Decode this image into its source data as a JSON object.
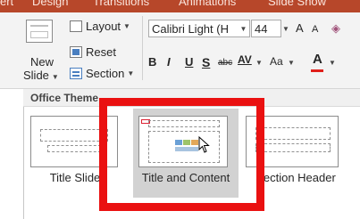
{
  "ribbon_tabs": [
    "ert",
    "Design",
    "Transitions",
    "Animations",
    "Slide Show"
  ],
  "slides_group": {
    "new_slide_line1": "New",
    "new_slide_line2": "Slide",
    "layout_label": "Layout",
    "reset_label": "Reset",
    "section_label": "Section"
  },
  "font_group": {
    "font_name": "Calibri Light (H",
    "font_size": "44",
    "grow_label": "A",
    "shrink_label": "A",
    "bold": "B",
    "italic": "I",
    "underline": "U",
    "shadow": "S",
    "strikethrough": "abc",
    "spacing": "AV",
    "change_case": "Aa",
    "font_color": "A"
  },
  "gallery": {
    "header": "Office Theme",
    "layouts": [
      {
        "name": "Title Slide",
        "selected": false
      },
      {
        "name": "Title and Content",
        "selected": true
      },
      {
        "name": "Section Header",
        "selected": false
      }
    ]
  },
  "highlight_color": "#ea1111",
  "ribbon_accent": "#b7472a"
}
